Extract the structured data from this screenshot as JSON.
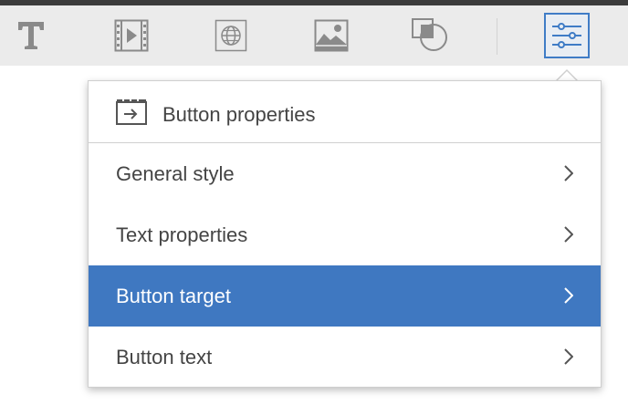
{
  "toolbar": {
    "tools": [
      {
        "name": "text-tool",
        "icon": "text-icon"
      },
      {
        "name": "video-tool",
        "icon": "video-icon"
      },
      {
        "name": "web-tool",
        "icon": "globe-icon"
      },
      {
        "name": "image-tool",
        "icon": "image-icon"
      },
      {
        "name": "shape-tool",
        "icon": "shape-icon"
      },
      {
        "name": "properties-tool",
        "icon": "sliders-icon",
        "active": true
      }
    ]
  },
  "panel": {
    "header": {
      "icon": "button-target-icon",
      "title": "Button properties"
    },
    "items": [
      {
        "label": "General style",
        "selected": false
      },
      {
        "label": "Text properties",
        "selected": false
      },
      {
        "label": "Button target",
        "selected": true
      },
      {
        "label": "Button text",
        "selected": false
      }
    ]
  },
  "colors": {
    "accent": "#3f78c1",
    "toolbar_bg": "#ebebeb",
    "icon_gray": "#8a8a8a",
    "text": "#444444"
  }
}
